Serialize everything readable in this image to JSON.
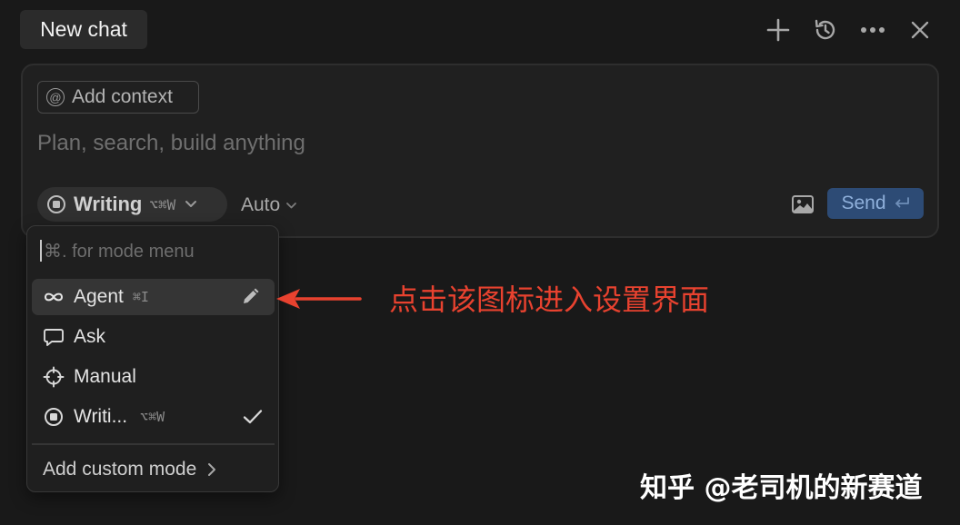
{
  "header": {
    "tab_title": "New chat",
    "actions": [
      {
        "name": "new-chat",
        "icon": "plus-icon"
      },
      {
        "name": "history",
        "icon": "history-icon"
      },
      {
        "name": "more",
        "icon": "ellipsis-icon"
      },
      {
        "name": "close",
        "icon": "close-icon"
      }
    ]
  },
  "composer": {
    "add_context_label": "Add context",
    "placeholder": "Plan, search, build anything",
    "mode": {
      "label": "Writing",
      "shortcut": "⌥⌘W"
    },
    "model_label": "Auto",
    "send_label": "Send"
  },
  "mode_menu": {
    "search_placeholder": "⌘. for mode menu",
    "items": [
      {
        "label": "Agent",
        "shortcut": "⌘I",
        "icon": "infinity-icon",
        "highlighted": true,
        "editable": true,
        "selected": false
      },
      {
        "label": "Ask",
        "shortcut": "",
        "icon": "chat-bubble-icon",
        "highlighted": false,
        "editable": false,
        "selected": false
      },
      {
        "label": "Manual",
        "shortcut": "",
        "icon": "crosshair-icon",
        "highlighted": false,
        "editable": false,
        "selected": false
      },
      {
        "label": "Writi...",
        "shortcut": "⌥⌘W",
        "icon": "stop-circle-icon",
        "highlighted": false,
        "editable": false,
        "selected": true
      }
    ],
    "add_custom_label": "Add custom mode"
  },
  "annotation": {
    "text": "点击该图标进入设置界面",
    "color": "#e8422f"
  },
  "watermark": "知乎 @老司机的新赛道",
  "colors": {
    "background": "#191919",
    "send_button": "#2d4b75",
    "annotation_red": "#e8422f"
  }
}
